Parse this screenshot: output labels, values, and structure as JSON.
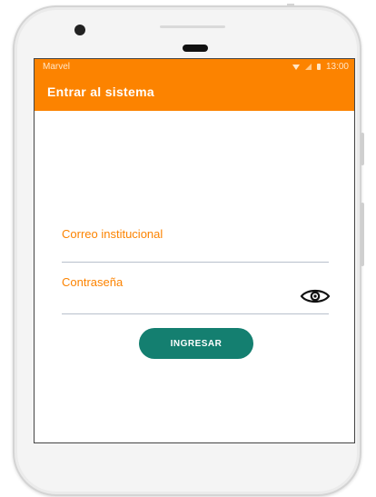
{
  "status_bar": {
    "carrier": "Marvel",
    "time": "13:00"
  },
  "appbar": {
    "title": "Entrar al sistema"
  },
  "form": {
    "email_label": "Correo institucional",
    "email_value": "",
    "password_label": "Contraseña",
    "password_value": "",
    "submit_label": "INGRESAR"
  },
  "colors": {
    "appbar": "#fc8300",
    "label": "#fc8300",
    "button": "#147f70",
    "underline": "#b8c0cc"
  },
  "icons": {
    "status": [
      "wifi-icon",
      "signal-icon",
      "battery-icon"
    ],
    "password_toggle": "eye-icon"
  }
}
